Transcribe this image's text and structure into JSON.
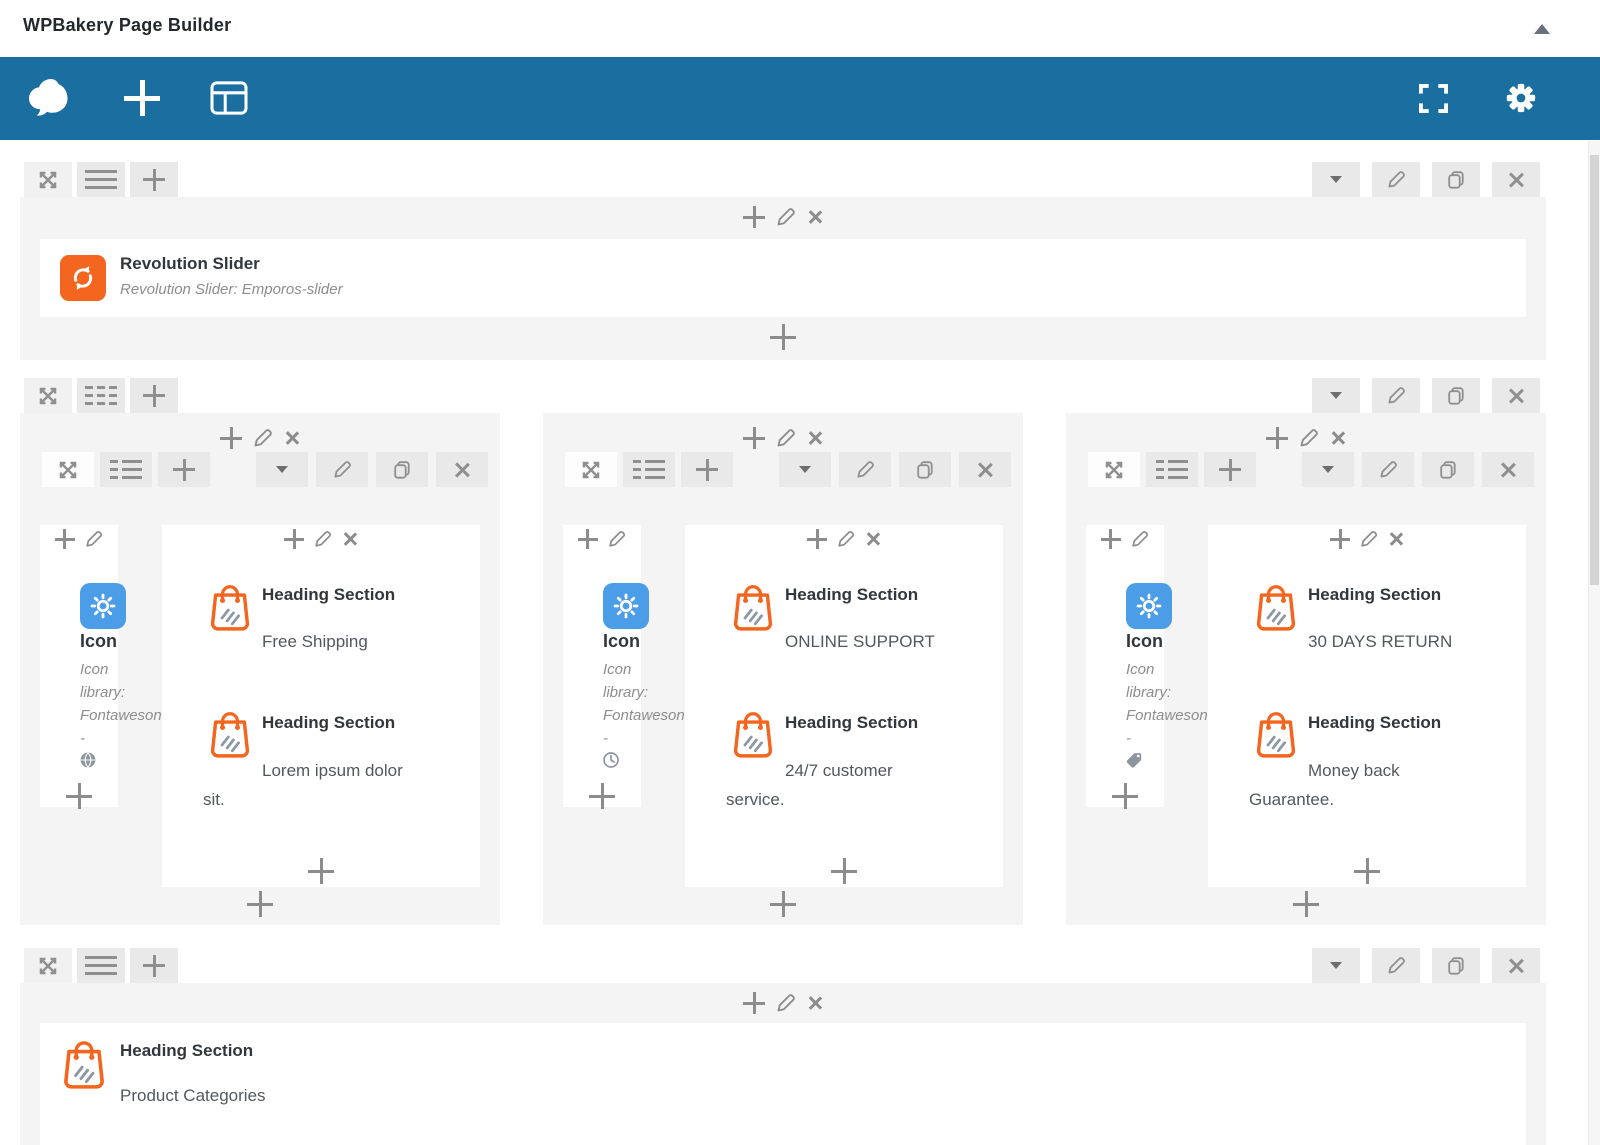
{
  "header": {
    "title": "WPBakery Page Builder"
  },
  "navbar": {
    "icons": [
      "wpbakery-logo",
      "add-element",
      "templates",
      "fullscreen",
      "settings"
    ]
  },
  "colors": {
    "navbar_blue": "#1b6ea0",
    "element_orange": "#f4661f",
    "element_blue": "#4b9de8"
  },
  "slider_row": {
    "element": {
      "title": "Revolution Slider",
      "subtitle": "Revolution Slider: Emporos-slider"
    }
  },
  "features_row": {
    "columns": [
      {
        "icon_element": {
          "title": "Icon",
          "meta": "Icon\nlibrary:\nFontaweson\n-",
          "glyph": "globe-icon"
        },
        "headings": [
          {
            "title": "Heading Section",
            "subtitle": "Free Shipping"
          },
          {
            "title": "Heading Section",
            "subtitle": "Lorem ipsum dolor sit."
          }
        ]
      },
      {
        "icon_element": {
          "title": "Icon",
          "meta": "Icon\nlibrary:\nFontaweson\n-",
          "glyph": "clock-icon"
        },
        "headings": [
          {
            "title": "Heading Section",
            "subtitle": "ONLINE SUPPORT"
          },
          {
            "title": "Heading Section",
            "subtitle": "24/7 customer service."
          }
        ]
      },
      {
        "icon_element": {
          "title": "Icon",
          "meta": "Icon\nlibrary:\nFontaweson\n-",
          "glyph": "tag-icon"
        },
        "headings": [
          {
            "title": "Heading Section",
            "subtitle": "30 DAYS RETURN"
          },
          {
            "title": "Heading Section",
            "subtitle": "Money back Guarantee."
          }
        ]
      }
    ]
  },
  "categories_row": {
    "element": {
      "title": "Heading Section",
      "subtitle": "Product Categories"
    }
  }
}
